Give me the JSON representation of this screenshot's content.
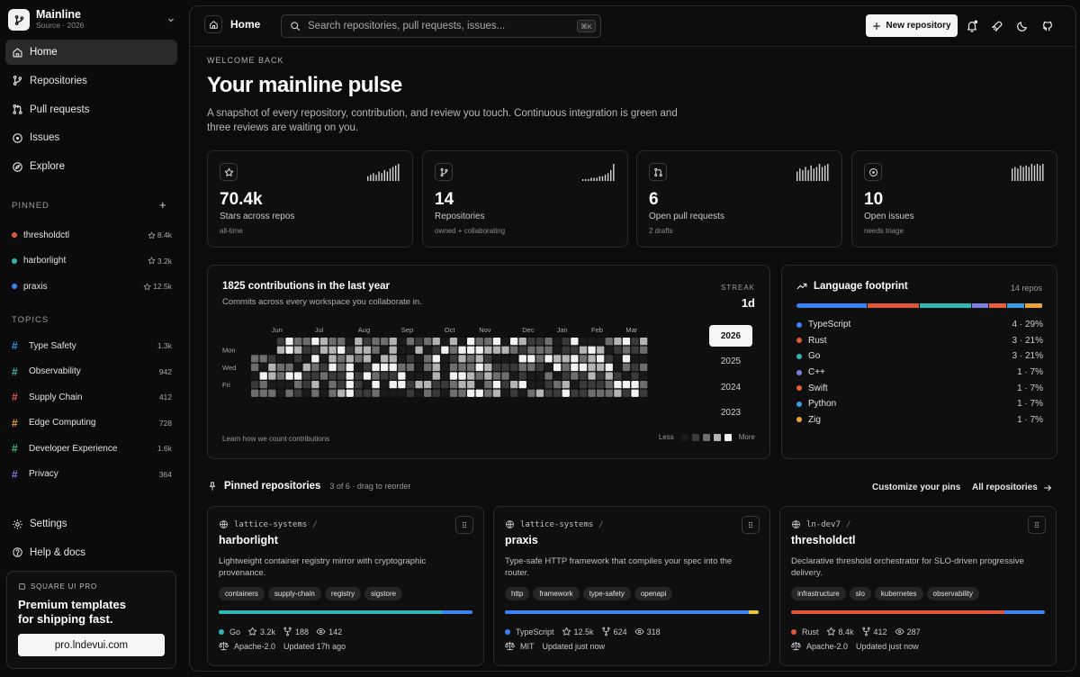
{
  "sidebar": {
    "workspace_name": "Mainline",
    "workspace_sub": "Source · 2026",
    "nav": [
      {
        "label": "Home",
        "icon": "home-icon",
        "active": true
      },
      {
        "label": "Repositories",
        "icon": "branch-icon"
      },
      {
        "label": "Pull requests",
        "icon": "pull-request-icon"
      },
      {
        "label": "Issues",
        "icon": "issue-icon"
      },
      {
        "label": "Explore",
        "icon": "compass-icon"
      }
    ],
    "pinned_label": "PINNED",
    "pinned": [
      {
        "name": "thresholdctl",
        "stars": "8.4k",
        "color": "#e0563b"
      },
      {
        "name": "harborlight",
        "stars": "3.2k",
        "color": "#2fb6b4"
      },
      {
        "name": "praxis",
        "stars": "12.5k",
        "color": "#3b82f6"
      }
    ],
    "topics_label": "TOPICS",
    "topics": [
      {
        "name": "Type Safety",
        "count": "1.3k",
        "color": "#3b8fe0"
      },
      {
        "name": "Observability",
        "count": "942",
        "color": "#2fb6b4"
      },
      {
        "name": "Supply Chain",
        "count": "412",
        "color": "#e0563b"
      },
      {
        "name": "Edge Computing",
        "count": "728",
        "color": "#e89b3b"
      },
      {
        "name": "Developer Experience",
        "count": "1.6k",
        "color": "#3fb96b"
      },
      {
        "name": "Privacy",
        "count": "364",
        "color": "#8b6fe0"
      }
    ],
    "bottom": [
      {
        "label": "Settings",
        "icon": "gear-icon"
      },
      {
        "label": "Help & docs",
        "icon": "help-icon"
      }
    ],
    "promo": {
      "label": "SQUARE UI PRO",
      "title_line1": "Premium templates",
      "title_line2": "for shipping fast.",
      "button": "pro.lndevui.com"
    }
  },
  "topbar": {
    "crumb": "Home",
    "search_placeholder": "Search repositories, pull requests, issues...",
    "shortcut": "⌘K",
    "new_repo": "New repository"
  },
  "hero": {
    "eyebrow": "WELCOME BACK",
    "title": "Your mainline pulse",
    "lead": "A snapshot of every repository, contribution, and review you touch. Continuous integration is green and three reviews are waiting on you."
  },
  "stats": [
    {
      "value": "70.4k",
      "label": "Stars across repos",
      "sub": "all-time",
      "icon": "star-icon",
      "spark": [
        3,
        4,
        5,
        4,
        6,
        5,
        7,
        6,
        8,
        9,
        10,
        11
      ]
    },
    {
      "value": "14",
      "label": "Repositories",
      "sub": "owned + collaborating",
      "icon": "branch-icon",
      "spark": [
        1,
        1,
        1,
        2,
        2,
        2,
        3,
        3,
        4,
        5,
        7,
        11
      ]
    },
    {
      "value": "6",
      "label": "Open pull requests",
      "sub": "2 drafts",
      "icon": "pull-request-icon",
      "spark": [
        6,
        8,
        7,
        9,
        7,
        10,
        8,
        9,
        11,
        9,
        10,
        11
      ]
    },
    {
      "value": "10",
      "label": "Open issues",
      "sub": "needs triage",
      "icon": "issue-icon",
      "spark": [
        8,
        9,
        8,
        10,
        9,
        10,
        9,
        11,
        10,
        11,
        10,
        11
      ]
    }
  ],
  "contributions": {
    "title": "1825 contributions in the last year",
    "subtitle": "Commits across every workspace you collaborate in.",
    "streak_label": "STREAK",
    "streak_value": "1d",
    "months": [
      "Jun",
      "Jul",
      "Aug",
      "Sep",
      "Oct",
      "Nov",
      "Dec",
      "Jan",
      "Feb",
      "Mar"
    ],
    "days": [
      "Mon",
      "Wed",
      "Fri"
    ],
    "years": [
      {
        "label": "2026",
        "active": true
      },
      {
        "label": "2025"
      },
      {
        "label": "2024"
      },
      {
        "label": "2023"
      }
    ],
    "learn": "Learn how we count contributions",
    "less": "Less",
    "more": "More",
    "levels": [
      "#1a1a1c",
      "#3a3a3c",
      "#6e6e70",
      "#b4b4b6",
      "#f2f2f2"
    ]
  },
  "languages": {
    "title": "Language footprint",
    "count": "14 repos",
    "items": [
      {
        "name": "TypeScript",
        "repos": "4",
        "pct": "29%",
        "share": 29,
        "color": "#3b82f6"
      },
      {
        "name": "Rust",
        "repos": "3",
        "pct": "21%",
        "share": 21,
        "color": "#e0563b"
      },
      {
        "name": "Go",
        "repos": "3",
        "pct": "21%",
        "share": 21,
        "color": "#2fb6b4"
      },
      {
        "name": "C++",
        "repos": "1",
        "pct": "7%",
        "share": 7,
        "color": "#7b7fe0"
      },
      {
        "name": "Swift",
        "repos": "1",
        "pct": "7%",
        "share": 7,
        "color": "#e8603b"
      },
      {
        "name": "Python",
        "repos": "1",
        "pct": "7%",
        "share": 7,
        "color": "#3b9be0"
      },
      {
        "name": "Zig",
        "repos": "1",
        "pct": "7%",
        "share": 7,
        "color": "#e8a33b"
      }
    ]
  },
  "pinned_section": {
    "title": "Pinned repositories",
    "subtitle": "3 of 6 · drag to reorder",
    "customize": "Customize your pins",
    "all": "All repositories"
  },
  "cards": [
    {
      "owner": "lattice-systems",
      "name": "harborlight",
      "desc": "Lightweight container registry mirror with cryptographic provenance.",
      "tags": [
        "containers",
        "supply-chain",
        "registry",
        "sigstore"
      ],
      "bar": [
        {
          "share": 88,
          "color": "#2fb6b4"
        },
        {
          "share": 12,
          "color": "#3b82f6"
        }
      ],
      "lang": "Go",
      "lang_color": "#2fb6b4",
      "stars": "3.2k",
      "forks": "188",
      "watchers": "142",
      "license": "Apache-2.0",
      "updated": "Updated 17h ago"
    },
    {
      "owner": "lattice-systems",
      "name": "praxis",
      "desc": "Type-safe HTTP framework that compiles your spec into the router.",
      "tags": [
        "http",
        "framework",
        "type-safety",
        "openapi"
      ],
      "bar": [
        {
          "share": 96,
          "color": "#3b82f6"
        },
        {
          "share": 4,
          "color": "#e8c43b"
        }
      ],
      "lang": "TypeScript",
      "lang_color": "#3b82f6",
      "stars": "12.5k",
      "forks": "624",
      "watchers": "318",
      "license": "MIT",
      "updated": "Updated just now"
    },
    {
      "owner": "ln-dev7",
      "name": "thresholdctl",
      "desc": "Declarative threshold orchestrator for SLO-driven progressive delivery.",
      "tags": [
        "infrastructure",
        "slo",
        "kubernetes",
        "observability"
      ],
      "bar": [
        {
          "share": 84,
          "color": "#e0563b"
        },
        {
          "share": 16,
          "color": "#3b82f6"
        }
      ],
      "lang": "Rust",
      "lang_color": "#e0563b",
      "stars": "8.4k",
      "forks": "412",
      "watchers": "287",
      "license": "Apache-2.0",
      "updated": "Updated just now"
    }
  ]
}
